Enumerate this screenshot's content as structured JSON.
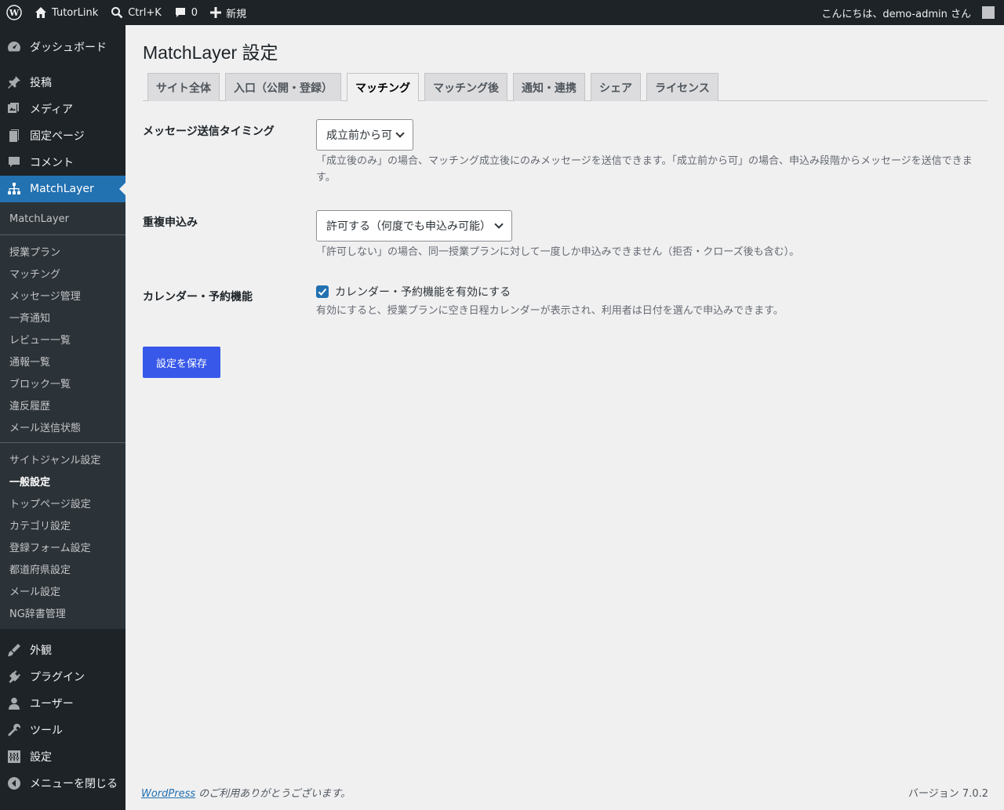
{
  "adminbar": {
    "wp_logo_icon": "wordpress-icon",
    "site_name": "TutorLink",
    "search_shortcut": "Ctrl+K",
    "comments_count": "0",
    "new_label": "新規",
    "greeting": "こんにちは、demo-admin さん"
  },
  "sidebar": {
    "dashboard": "ダッシュボード",
    "posts": "投稿",
    "media": "メディア",
    "pages": "固定ページ",
    "comments": "コメント",
    "matchlayer": "MatchLayer",
    "submenu_group1": [
      "MatchLayer"
    ],
    "submenu_group2": [
      "授業プラン",
      "マッチング",
      "メッセージ管理",
      "一斉通知",
      "レビュー一覧",
      "通報一覧",
      "ブロック一覧",
      "違反履歴",
      "メール送信状態"
    ],
    "submenu_group3": [
      "サイトジャンル設定",
      "一般設定",
      "トップページ設定",
      "カテゴリ設定",
      "登録フォーム設定",
      "都道府県設定",
      "メール設定",
      "NG辞書管理"
    ],
    "appearance": "外観",
    "plugins": "プラグイン",
    "users": "ユーザー",
    "tools": "ツール",
    "settings": "設定",
    "collapse": "メニューを閉じる"
  },
  "page": {
    "title": "MatchLayer 設定",
    "tabs": [
      "サイト全体",
      "入口（公開・登録）",
      "マッチング",
      "マッチング後",
      "通知・連携",
      "シェア",
      "ライセンス"
    ],
    "active_tab": "マッチング",
    "fields": {
      "message_timing": {
        "label": "メッセージ送信タイミング",
        "value": "成立前から可",
        "description": "「成立後のみ」の場合、マッチング成立後にのみメッセージを送信できます。「成立前から可」の場合、申込み段階からメッセージを送信できます。"
      },
      "duplicate": {
        "label": "重複申込み",
        "value": "許可する（何度でも申込み可能）",
        "description": "「許可しない」の場合、同一授業プランに対して一度しか申込みできません（拒否・クローズ後も含む）。"
      },
      "calendar": {
        "label": "カレンダー・予約機能",
        "checkbox_label": "カレンダー・予約機能を有効にする",
        "checked": true,
        "description": "有効にすると、授業プランに空き日程カレンダーが表示され、利用者は日付を選んで申込みできます。"
      }
    },
    "save_button": "設定を保存"
  },
  "footer": {
    "wordpress_link": "WordPress",
    "thanks": " のご利用ありがとうございます。",
    "version": "バージョン 7.0.2"
  }
}
